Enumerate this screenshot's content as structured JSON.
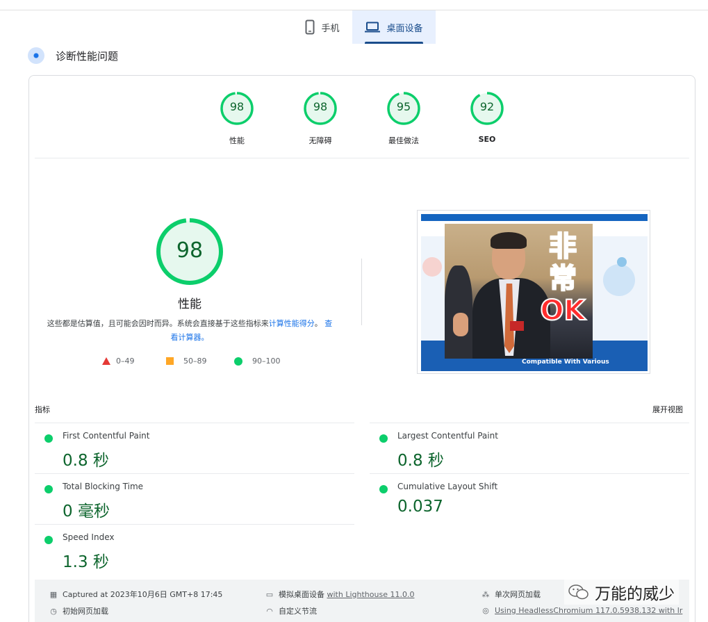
{
  "tabs": [
    {
      "label": "手机",
      "icon": "phone-icon",
      "active": false
    },
    {
      "label": "桌面设备",
      "icon": "laptop-icon",
      "active": true
    }
  ],
  "diagnose": {
    "title": "诊断性能问题"
  },
  "categories": [
    {
      "score": "98",
      "label": "性能"
    },
    {
      "score": "98",
      "label": "无障碍"
    },
    {
      "score": "95",
      "label": "最佳做法"
    },
    {
      "score": "92",
      "label": "SEO"
    }
  ],
  "performance": {
    "score": "98",
    "label": "性能",
    "note_text": "这些都是估算值，且可能会因时而异。系统会直接基于这些指标来",
    "note_link1": "计算性能得分",
    "note_mid": "。",
    "note_link2": "查看计算器。"
  },
  "legend": [
    {
      "range": "0–49",
      "color": "#e53935"
    },
    {
      "range": "50–89",
      "color": "#ffa726"
    },
    {
      "range": "90–100",
      "color": "#0cce6b"
    }
  ],
  "screenshot": {
    "caption": "Compatible With Various",
    "meme_text": [
      "非",
      "常",
      "OK"
    ]
  },
  "metrics": {
    "header": "指标",
    "expand": "展开视图",
    "items": [
      {
        "name": "First Contentful Paint",
        "value": "0.8 秒"
      },
      {
        "name": "Largest Contentful Paint",
        "value": "0.8 秒"
      },
      {
        "name": "Total Blocking Time",
        "value": "0 毫秒"
      },
      {
        "name": "Cumulative Layout Shift",
        "value": "0.037"
      },
      {
        "name": "Speed Index",
        "value": "1.3 秒"
      }
    ]
  },
  "footer": {
    "captured": "Captured at 2023年10月6日 GMT+8 17:45",
    "initial_load": "初始网页加载",
    "emulated_prefix": "模拟桌面设备",
    "emulated_suffix": "with Lighthouse 11.0.0",
    "throttling": "自定义节流",
    "single_load": "单次网页加载",
    "browser": "Using HeadlessChromium 117.0.5938.132 with lr"
  },
  "watermark": "万能的威少",
  "colors": {
    "pass": "#0cce6b",
    "pass_text": "#0d652d",
    "accent": "#1a73e8",
    "tab_active": "#1a4d8c"
  }
}
